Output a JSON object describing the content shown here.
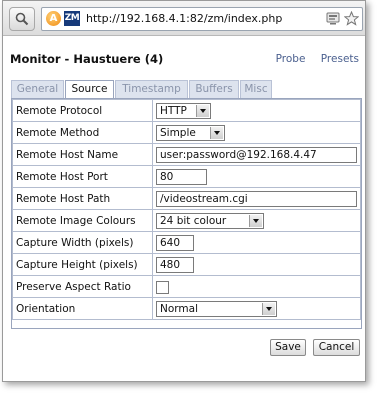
{
  "browser": {
    "url": "http://192.168.4.1:82/zm/index.php",
    "favicon_a": "A",
    "favicon_zm": "ZM"
  },
  "header": {
    "title": "Monitor - Haustuere (4)",
    "links": [
      "Probe",
      "Presets"
    ]
  },
  "tabs": [
    {
      "label": "General"
    },
    {
      "label": "Source"
    },
    {
      "label": "Timestamp"
    },
    {
      "label": "Buffers"
    },
    {
      "label": "Misc"
    }
  ],
  "active_tab": "Source",
  "form": {
    "rows": [
      {
        "label": "Remote Protocol",
        "type": "select",
        "value": "HTTP"
      },
      {
        "label": "Remote Method",
        "type": "select",
        "value": "Simple"
      },
      {
        "label": "Remote Host Name",
        "type": "text",
        "value": "user:password@192.168.4.47"
      },
      {
        "label": "Remote Host Port",
        "type": "text",
        "value": "80"
      },
      {
        "label": "Remote Host Path",
        "type": "text",
        "value": "/videostream.cgi"
      },
      {
        "label": "Remote Image Colours",
        "type": "select",
        "value": "24 bit colour"
      },
      {
        "label": "Capture Width (pixels)",
        "type": "text",
        "value": "640"
      },
      {
        "label": "Capture Height (pixels)",
        "type": "text",
        "value": "480"
      },
      {
        "label": "Preserve Aspect Ratio",
        "type": "checkbox",
        "checked": false
      },
      {
        "label": "Orientation",
        "type": "select",
        "value": "Normal"
      }
    ]
  },
  "buttons": {
    "save": "Save",
    "cancel": "Cancel"
  },
  "icons": {
    "search": "search-icon",
    "rss": "rss-icon",
    "bookmark": "star-icon"
  }
}
